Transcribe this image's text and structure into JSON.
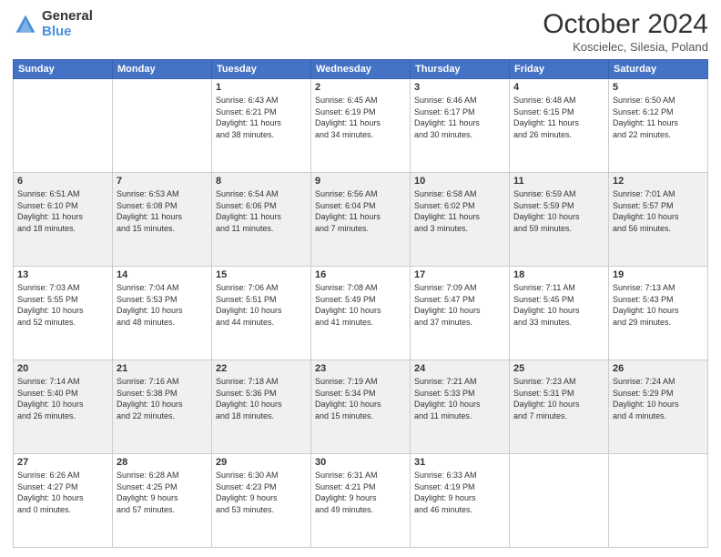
{
  "header": {
    "logo_general": "General",
    "logo_blue": "Blue",
    "month_title": "October 2024",
    "location": "Koscielec, Silesia, Poland"
  },
  "days_of_week": [
    "Sunday",
    "Monday",
    "Tuesday",
    "Wednesday",
    "Thursday",
    "Friday",
    "Saturday"
  ],
  "weeks": [
    [
      {
        "day": "",
        "info": ""
      },
      {
        "day": "",
        "info": ""
      },
      {
        "day": "1",
        "info": "Sunrise: 6:43 AM\nSunset: 6:21 PM\nDaylight: 11 hours\nand 38 minutes."
      },
      {
        "day": "2",
        "info": "Sunrise: 6:45 AM\nSunset: 6:19 PM\nDaylight: 11 hours\nand 34 minutes."
      },
      {
        "day": "3",
        "info": "Sunrise: 6:46 AM\nSunset: 6:17 PM\nDaylight: 11 hours\nand 30 minutes."
      },
      {
        "day": "4",
        "info": "Sunrise: 6:48 AM\nSunset: 6:15 PM\nDaylight: 11 hours\nand 26 minutes."
      },
      {
        "day": "5",
        "info": "Sunrise: 6:50 AM\nSunset: 6:12 PM\nDaylight: 11 hours\nand 22 minutes."
      }
    ],
    [
      {
        "day": "6",
        "info": "Sunrise: 6:51 AM\nSunset: 6:10 PM\nDaylight: 11 hours\nand 18 minutes."
      },
      {
        "day": "7",
        "info": "Sunrise: 6:53 AM\nSunset: 6:08 PM\nDaylight: 11 hours\nand 15 minutes."
      },
      {
        "day": "8",
        "info": "Sunrise: 6:54 AM\nSunset: 6:06 PM\nDaylight: 11 hours\nand 11 minutes."
      },
      {
        "day": "9",
        "info": "Sunrise: 6:56 AM\nSunset: 6:04 PM\nDaylight: 11 hours\nand 7 minutes."
      },
      {
        "day": "10",
        "info": "Sunrise: 6:58 AM\nSunset: 6:02 PM\nDaylight: 11 hours\nand 3 minutes."
      },
      {
        "day": "11",
        "info": "Sunrise: 6:59 AM\nSunset: 5:59 PM\nDaylight: 10 hours\nand 59 minutes."
      },
      {
        "day": "12",
        "info": "Sunrise: 7:01 AM\nSunset: 5:57 PM\nDaylight: 10 hours\nand 56 minutes."
      }
    ],
    [
      {
        "day": "13",
        "info": "Sunrise: 7:03 AM\nSunset: 5:55 PM\nDaylight: 10 hours\nand 52 minutes."
      },
      {
        "day": "14",
        "info": "Sunrise: 7:04 AM\nSunset: 5:53 PM\nDaylight: 10 hours\nand 48 minutes."
      },
      {
        "day": "15",
        "info": "Sunrise: 7:06 AM\nSunset: 5:51 PM\nDaylight: 10 hours\nand 44 minutes."
      },
      {
        "day": "16",
        "info": "Sunrise: 7:08 AM\nSunset: 5:49 PM\nDaylight: 10 hours\nand 41 minutes."
      },
      {
        "day": "17",
        "info": "Sunrise: 7:09 AM\nSunset: 5:47 PM\nDaylight: 10 hours\nand 37 minutes."
      },
      {
        "day": "18",
        "info": "Sunrise: 7:11 AM\nSunset: 5:45 PM\nDaylight: 10 hours\nand 33 minutes."
      },
      {
        "day": "19",
        "info": "Sunrise: 7:13 AM\nSunset: 5:43 PM\nDaylight: 10 hours\nand 29 minutes."
      }
    ],
    [
      {
        "day": "20",
        "info": "Sunrise: 7:14 AM\nSunset: 5:40 PM\nDaylight: 10 hours\nand 26 minutes."
      },
      {
        "day": "21",
        "info": "Sunrise: 7:16 AM\nSunset: 5:38 PM\nDaylight: 10 hours\nand 22 minutes."
      },
      {
        "day": "22",
        "info": "Sunrise: 7:18 AM\nSunset: 5:36 PM\nDaylight: 10 hours\nand 18 minutes."
      },
      {
        "day": "23",
        "info": "Sunrise: 7:19 AM\nSunset: 5:34 PM\nDaylight: 10 hours\nand 15 minutes."
      },
      {
        "day": "24",
        "info": "Sunrise: 7:21 AM\nSunset: 5:33 PM\nDaylight: 10 hours\nand 11 minutes."
      },
      {
        "day": "25",
        "info": "Sunrise: 7:23 AM\nSunset: 5:31 PM\nDaylight: 10 hours\nand 7 minutes."
      },
      {
        "day": "26",
        "info": "Sunrise: 7:24 AM\nSunset: 5:29 PM\nDaylight: 10 hours\nand 4 minutes."
      }
    ],
    [
      {
        "day": "27",
        "info": "Sunrise: 6:26 AM\nSunset: 4:27 PM\nDaylight: 10 hours\nand 0 minutes."
      },
      {
        "day": "28",
        "info": "Sunrise: 6:28 AM\nSunset: 4:25 PM\nDaylight: 9 hours\nand 57 minutes."
      },
      {
        "day": "29",
        "info": "Sunrise: 6:30 AM\nSunset: 4:23 PM\nDaylight: 9 hours\nand 53 minutes."
      },
      {
        "day": "30",
        "info": "Sunrise: 6:31 AM\nSunset: 4:21 PM\nDaylight: 9 hours\nand 49 minutes."
      },
      {
        "day": "31",
        "info": "Sunrise: 6:33 AM\nSunset: 4:19 PM\nDaylight: 9 hours\nand 46 minutes."
      },
      {
        "day": "",
        "info": ""
      },
      {
        "day": "",
        "info": ""
      }
    ]
  ]
}
